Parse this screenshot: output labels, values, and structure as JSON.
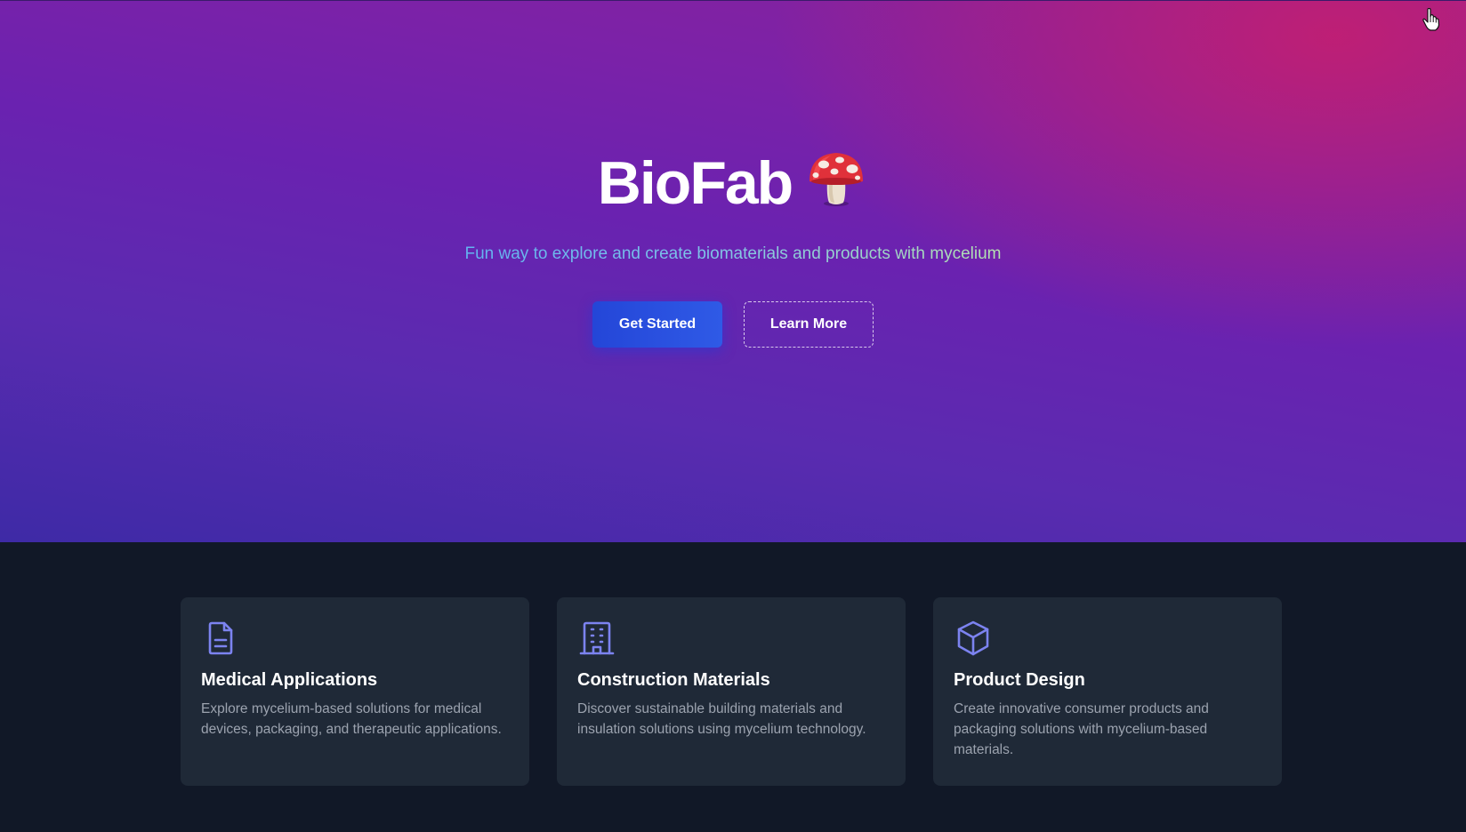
{
  "hero": {
    "title": "BioFab",
    "emoji_icon": "mushroom-icon",
    "subtitle": "Fun way to explore and create biomaterials and products with mycelium",
    "buttons": {
      "primary_label": "Get Started",
      "secondary_label": "Learn More"
    },
    "colors": {
      "gradient_start": "#3e2aa6",
      "gradient_mid": "#6a22b0",
      "gradient_accent": "#c81e6e",
      "primary_button": "#2446d8"
    }
  },
  "features": {
    "cards": [
      {
        "icon": "document-icon",
        "title": "Medical Applications",
        "text": "Explore mycelium-based solutions for medical devices, packaging, and therapeutic applications."
      },
      {
        "icon": "building-icon",
        "title": "Construction Materials",
        "text": "Discover sustainable building materials and insulation solutions using mycelium technology."
      },
      {
        "icon": "cube-icon",
        "title": "Product Design",
        "text": "Create innovative consumer products and packaging solutions with mycelium-based materials."
      }
    ],
    "colors": {
      "background": "#111827",
      "card_background": "#1f2937",
      "icon_color": "#7c83f0",
      "text_muted": "#9ca3af"
    }
  }
}
